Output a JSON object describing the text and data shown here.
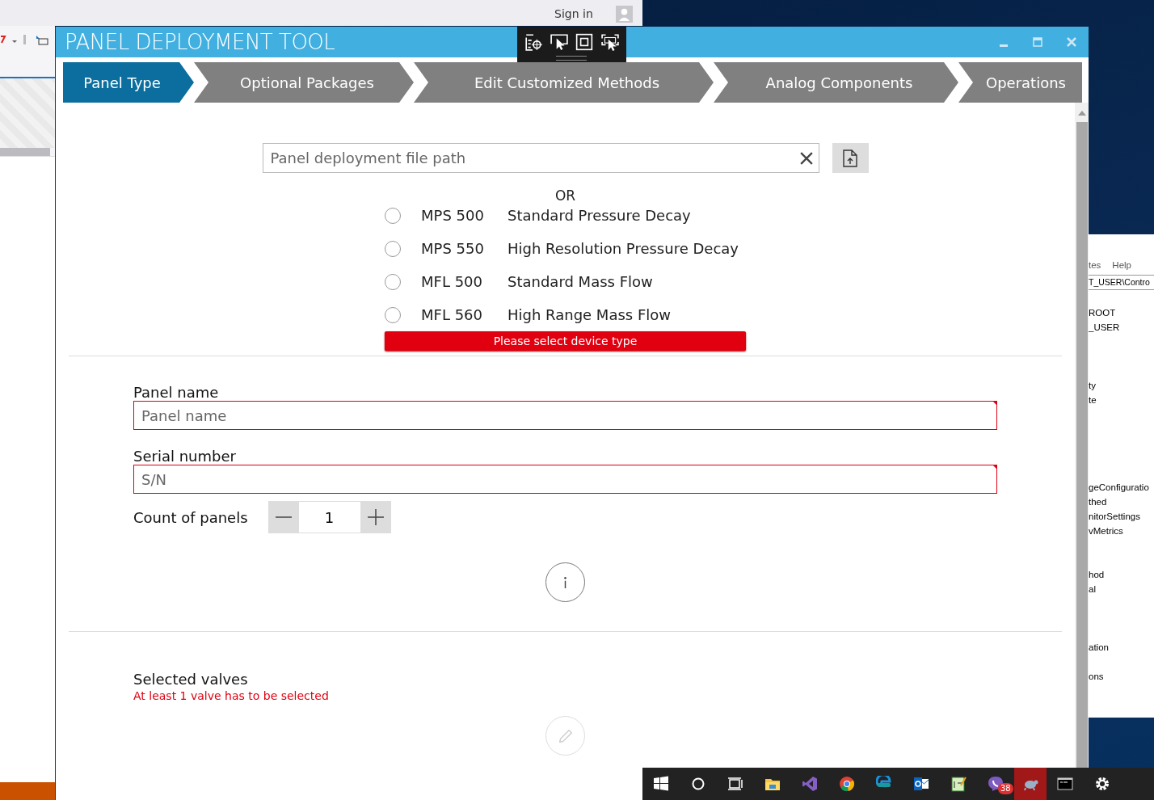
{
  "background_ide": {
    "sign_in": "Sign in"
  },
  "registry_window": {
    "menu": [
      "tes",
      "Help"
    ],
    "path": "T_USER\\Contro",
    "groups": [
      [
        "ROOT",
        "_USER"
      ],
      [
        "ty",
        "te"
      ],
      [
        "geConfiguratio",
        "thed",
        "nitorSettings",
        "vMetrics"
      ],
      [
        "hod",
        "al"
      ],
      [
        "ation"
      ],
      [
        "ons"
      ]
    ]
  },
  "window": {
    "title": "PANEL DEPLOYMENT TOOL"
  },
  "steps": [
    {
      "label": "Panel Type",
      "selected": true
    },
    {
      "label": "Optional Packages",
      "selected": false
    },
    {
      "label": "Edit Customized Methods",
      "selected": false
    },
    {
      "label": "Analog Components",
      "selected": false
    },
    {
      "label": "Operations",
      "selected": false
    }
  ],
  "file_path": {
    "placeholder": "Panel deployment file path"
  },
  "or_label": "OR",
  "device_types": [
    {
      "model": "MPS 500",
      "description": "Standard Pressure Decay",
      "selected": false
    },
    {
      "model": "MPS 550",
      "description": "High Resolution Pressure Decay",
      "selected": false
    },
    {
      "model": "MFL 500",
      "description": "Standard Mass Flow",
      "selected": false
    },
    {
      "model": "MFL 560",
      "description": "High Range Mass Flow",
      "selected": false
    }
  ],
  "device_error": "Please select device type",
  "panel_name": {
    "label": "Panel name",
    "placeholder": "Panel name",
    "invalid": true
  },
  "serial_number": {
    "label": "Serial number",
    "placeholder": "S/N",
    "invalid": true
  },
  "count": {
    "label": "Count of panels",
    "value": "1"
  },
  "selected_valves": {
    "label": "Selected valves",
    "error": "At least 1 valve has to be selected"
  },
  "taskbar": {
    "chat_badge": "38"
  }
}
